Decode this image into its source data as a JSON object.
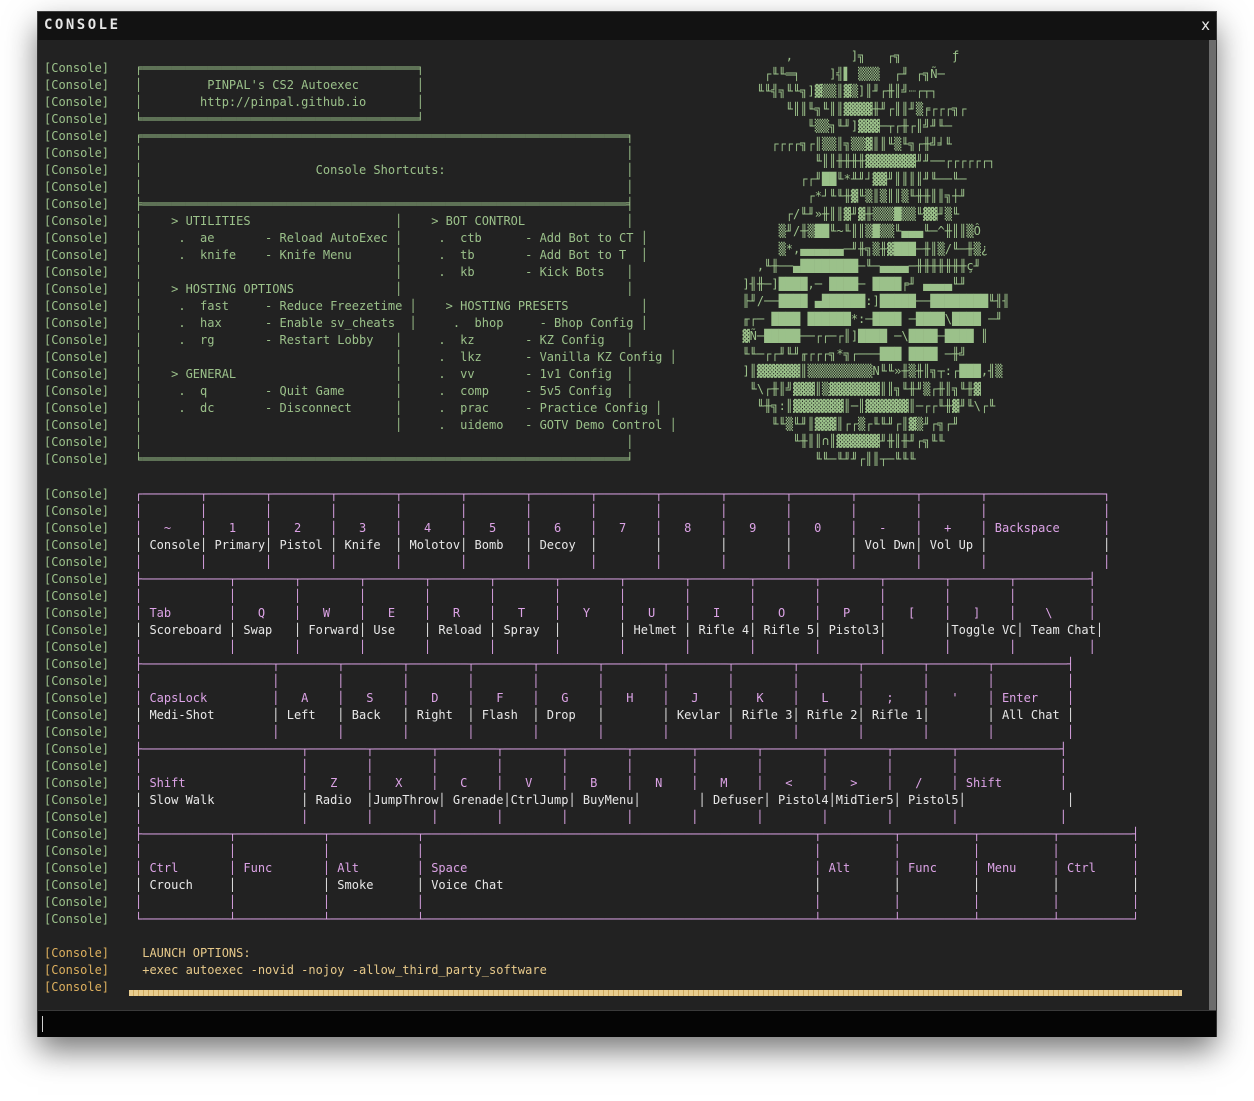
{
  "window": {
    "title": "CONSOLE",
    "close_label": "x"
  },
  "prefix": "[Console]",
  "art_lines": [
    "        ,        ]╗   ┌╗       ƒ",
    "     ┌╙╙═╕    ]╣▌ ▒▒▒  ┌╜ ┌╗Ñ─",
    "    ╙╙╣╗╙╙╗]▓▒▒║▓▒]║╜┌╫║╝┈┌┬┐",
    "        ╙║║╙╗╙║║▓▓▓▓╫╜┌║║╜▒╒┌┌┌╗┌",
    "           ╙▒▒╗╙╜]▓▓▓─┬┌╫┌║╝╜╙─",
    "      ┌┌┌┌╗┌║▒▒║╗▒▒▓║║╙▒╙╗┌╫╝╛╙",
    "            ╙║║╫╫╫╫▓▓▓▓▓▓▓╜╜──┌┌┌┌┌┌┐",
    "          ┌┌╜██╙*╨╜┘▓▓╜║║║║╜╙──╙─",
    "           ┌*┘╙╙╫▓╙▒║▒║║▒╙╫╫║║╗┼╜",
    "        ┌/╙╜»╫║║▓╜▓╫▒▒▒█▒▒╙▓▓╜▒╙",
    "       ▒╜/╫▒██╙~╙║║▒█▒▒╙▄▄▄╙─^╫║║▒Ô",
    "       ▒*,▄▄▄▄▄▄─╜╫╗▒╫▓███─╫║▒/╙─╫▒¿",
    "    ,╙╫──▄████████─╙─▄▄▄▄─╫╫╫╫╫╫╫ç╜",
    "  ]╢╫─]████,─ ████─ ████╒╜ ▄▄▄▄╙╜",
    "  ╟╜/──████ ▄██████:]█████──████████╙╢╢",
    "  ╓┌─ ████ ██████*:─████ ─████\\████ ─╜",
    "  ▓Ñ─█████──┌┌─┌║]████ ─\\████─████ ║",
    "  ╙╙─┌┌╜╙╜╓┌┌┌╗*╗┌───███ ████ ─╫╝",
    "  ]║▓▓▓▓▓▓║▒▒▒▒▒▒▒▒▒N╙╙»╫▒╫║╗┬:┌███,╢▒",
    "   ╙\\┌╫║╝▓▓▓║▒▓▓▓▓▓▓▓║║╗╙╫╜▒┌╫║╗╙╫▓",
    "    ╙╫╗:║▓▓▓▓▓▓▓║─║▓▓▓▓▓▓║─┌┌╙╫▓╜╙\\┌╙",
    "      ╙╙▒╙╜║▓▓▓║┌┌▒┌╙╙╜┌║▓▒╜┌╗┌╜",
    "         ╙╫║║∩║▓▓▓▓▓▓╜╫║╫╜┌╗╙╙",
    "            ╙╙─╙╜╜┌║║┬─╙╙╙"
  ],
  "lines": [
    {
      "t": "╒══════════════════════════════════════╕",
      "c": "green"
    },
    {
      "t": "│         PINPAL's CS2 Autoexec        │",
      "c": "green"
    },
    {
      "t": "│        http://pinpal.github.io       │",
      "c": "green"
    },
    {
      "t": "╘══════════════════════════════════════╛",
      "c": "green"
    },
    {
      "t": "╒═══════════════════════════════════════════════════════════════════╕",
      "c": "green"
    },
    {
      "t": "│                                                                   │",
      "c": "green"
    },
    {
      "t": "│                        Console Shortcuts:                         │",
      "c": "green"
    },
    {
      "t": "│                                                                   │",
      "c": "green"
    },
    {
      "t": "╞═══════════════════════════════════════════════════════════════════╡",
      "c": "green"
    },
    {
      "t": "│    > UTILITIES                    │    > BOT CONTROL              │",
      "c": "green"
    },
    {
      "t": "│     .  ae       - Reload AutoExec │     .  ctb      - Add Bot to CT │",
      "c": "green"
    },
    {
      "t": "│     .  knife    - Knife Menu      │     .  tb       - Add Bot to T  │",
      "c": "green"
    },
    {
      "t": "│                                   │     .  kb       - Kick Bots   │",
      "c": "green"
    },
    {
      "t": "│    > HOSTING OPTIONS              │                               │",
      "c": "green"
    },
    {
      "t": "│     .  fast     - Reduce Freezetime │    > HOSTING PRESETS          │",
      "c": "green"
    },
    {
      "t": "│     .  hax      - Enable sv_cheats  │     .  bhop     - Bhop Config │",
      "c": "green"
    },
    {
      "t": "│     .  rg       - Restart Lobby   │     .  kz       - KZ Config   │",
      "c": "green"
    },
    {
      "t": "│                                   │     .  lkz      - Vanilla KZ Config │",
      "c": "green"
    },
    {
      "t": "│    > GENERAL                      │     .  vv       - 1v1 Config  │",
      "c": "green"
    },
    {
      "t": "│     .  q        - Quit Game       │     .  comp     - 5v5 Config  │",
      "c": "green"
    },
    {
      "t": "│     .  dc       - Disconnect      │     .  prac     - Practice Config │",
      "c": "green"
    },
    {
      "t": "│                                   │     .  uidemo   - GOTV Demo Control │",
      "c": "green"
    },
    {
      "t": "│                                                                   │",
      "c": "green"
    },
    {
      "t": "╘═══════════════════════════════════════════════════════════════════╛",
      "c": "green"
    },
    {
      "t": "",
      "c": "green",
      "blank": true
    },
    {
      "t": "┌────────┬────────┬────────┬────────┬────────┬────────┬────────┬────────┬────────┬────────┬────────┬────────┬────────┬────────────────┐",
      "c": "pink"
    },
    {
      "t": "│        │        │        │        │        │        │        │        │        │        │        │        │        │                │",
      "c": "pink"
    },
    {
      "t": "│   ~    │   1    │   2    │   3    │   4    │   5    │   6    │   7    │   8    │   9    │   0    │   -    │   +    │ Backspace      │",
      "c": "pink"
    },
    {
      "t": "│ Console│ Primary│ Pistol │ Knife  │ Molotov│ Bomb   │ Decoy  │        │        │        │        │ Vol Dwn│ Vol Up │                │",
      "c": "white"
    },
    {
      "t": "│        │        │        │        │        │        │        │        │        │        │        │        │        │                │",
      "c": "pink"
    },
    {
      "t": "├────────────┬────────┬────────┬────────┬────────┬────────┬────────┬────────┬────────┬────────┬────────┬────────┬────────┬──────────┤",
      "c": "pink"
    },
    {
      "t": "│            │        │        │        │        │        │        │        │        │        │        │        │        │          │",
      "c": "pink"
    },
    {
      "t": "│ Tab        │   Q    │   W    │   E    │   R    │   T    │   Y    │   U    │   I    │   O    │   P    │   [    │   ]    │    \\     │",
      "c": "pink"
    },
    {
      "t": "│ Scoreboard │ Swap   │ Forward│ Use    │ Reload │ Spray  │        │ Helmet │ Rifle 4│ Rifle 5│ Pistol3│        │Toggle VC│ Team Chat│",
      "c": "white"
    },
    {
      "t": "│            │        │        │        │        │        │        │        │        │        │        │        │        │          │",
      "c": "pink"
    },
    {
      "t": "├──────────────────┬────────┬────────┬────────┬────────┬────────┬────────┬────────┬────────┬────────┬────────┬────────┬──────────┤",
      "c": "pink"
    },
    {
      "t": "│                  │        │        │        │        │        │        │        │        │        │        │        │          │",
      "c": "pink"
    },
    {
      "t": "│ CapsLock         │   A    │   S    │   D    │   F    │   G    │   H    │   J    │   K    │   L    │   ;    │   '    │ Enter    │",
      "c": "pink"
    },
    {
      "t": "│ Medi-Shot        │ Left   │ Back   │ Right  │ Flash  │ Drop   │        │ Kevlar │ Rifle 3│ Rifle 2│ Rifle 1│        │ All Chat │",
      "c": "white"
    },
    {
      "t": "│                  │        │        │        │        │        │        │        │        │        │        │        │          │",
      "c": "pink"
    },
    {
      "t": "├──────────────────────┬────────┬────────┬────────┬────────┬────────┬────────┬────────┬────────┬────────┬────────┬──────────────┤",
      "c": "pink"
    },
    {
      "t": "│                      │        │        │        │        │        │        │        │        │        │        │              │",
      "c": "pink"
    },
    {
      "t": "│ Shift                │   Z    │   X    │   C    │   V    │   B    │   N    │   M    │   <    │   >    │   /    │ Shift        │",
      "c": "pink"
    },
    {
      "t": "│ Slow Walk            │ Radio  │JumpThrow│ Grenade│CtrlJump│ BuyMenu│        │ Defuser│ Pistol4│MidTier5│ Pistol5│              │",
      "c": "white"
    },
    {
      "t": "│                      │        │        │        │        │        │        │        │        │        │        │              │",
      "c": "pink"
    },
    {
      "t": "├────────────┬────────────┬────────────┬──────────────────────────────────────────────────────┬──────────┬──────────┬──────────┬──────────┤",
      "c": "pink"
    },
    {
      "t": "│            │            │            │                                                      │          │          │          │          │",
      "c": "pink"
    },
    {
      "t": "│ Ctrl       │ Func       │ Alt        │ Space                                                │ Alt      │ Func     │ Menu     │ Ctrl     │",
      "c": "pink"
    },
    {
      "t": "│ Crouch     │            │ Smoke      │ Voice Chat                                           │          │          │          │          │",
      "c": "white"
    },
    {
      "t": "│            │            │            │                                                      │          │          │          │          │",
      "c": "pink"
    },
    {
      "t": "└────────────┴────────────┴────────────┴──────────────────────────────────────────────────────┴──────────┴──────────┴──────────┴──────────┘",
      "c": "pink"
    },
    {
      "t": "",
      "c": "green",
      "blank": true
    },
    {
      "t": " LAUNCH OPTIONS:",
      "c": "orange-txt",
      "orange": true
    },
    {
      "t": " +exec autoexec -novid -nojoy -allow_third_party_software",
      "c": "orange-txt",
      "orange": true
    },
    {
      "t": "",
      "c": "orange-txt",
      "orange": true
    }
  ]
}
